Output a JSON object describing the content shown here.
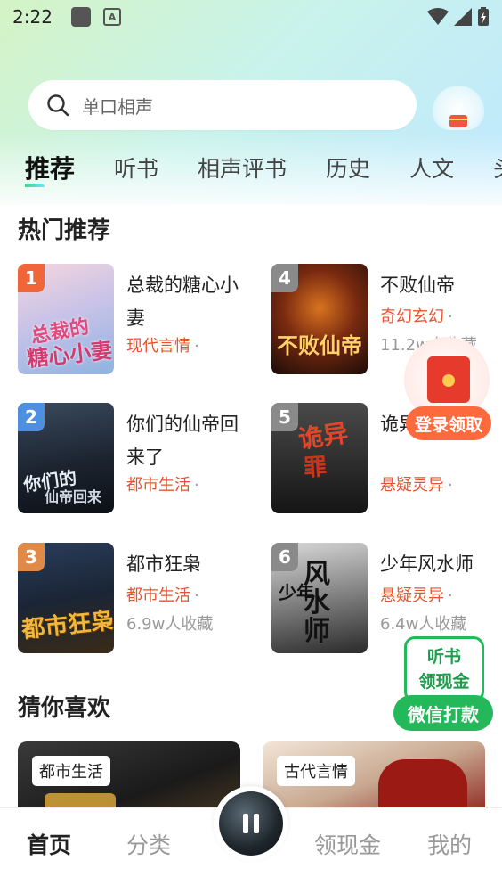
{
  "status_bar": {
    "time": "2:22",
    "icons": [
      "notification-square-icon",
      "font-a-icon",
      "wifi-icon",
      "signal-icon",
      "battery-charging-icon"
    ]
  },
  "search": {
    "placeholder": "单口相声"
  },
  "tabs": [
    "推荐",
    "听书",
    "相声评书",
    "历史",
    "人文",
    "头"
  ],
  "hot_section": {
    "title": "热门推荐",
    "books": [
      {
        "rank": "1",
        "title": "总裁的糖心小妻",
        "genre": "现代言情",
        "count": ""
      },
      {
        "rank": "2",
        "title": "你们的仙帝回来了",
        "genre": "都市生活",
        "count": ""
      },
      {
        "rank": "3",
        "title": "都市狂枭",
        "genre": "都市生活",
        "count": "6.9w人收藏"
      },
      {
        "rank": "4",
        "title": "不败仙帝",
        "genre": "奇幻玄幻",
        "count": "11.2w人收藏"
      },
      {
        "rank": "5",
        "title": "诡异演罪师",
        "genre": "悬疑灵异",
        "count": ""
      },
      {
        "rank": "6",
        "title": "少年风水师",
        "genre": "悬疑灵异",
        "count": "6.4w人收藏"
      }
    ]
  },
  "float_redpack": {
    "label": "登录领取"
  },
  "float_listen": {
    "line1": "听书",
    "line2": "领现金",
    "button": "微信打款"
  },
  "guess_section": {
    "title": "猜你喜欢",
    "cards": [
      {
        "tag": "都市生活"
      },
      {
        "tag": "古代言情"
      }
    ]
  },
  "bottom_nav": {
    "home": "首页",
    "category": "分类",
    "cash": "领现金",
    "mine": "我的"
  },
  "colors": {
    "genre": "#e8532f",
    "green": "#23b85a",
    "rank_1": "#f0653a",
    "rank_2": "#4f8fe0",
    "rank_3": "#e08a4a",
    "rank_other": "#8a8a8a"
  }
}
